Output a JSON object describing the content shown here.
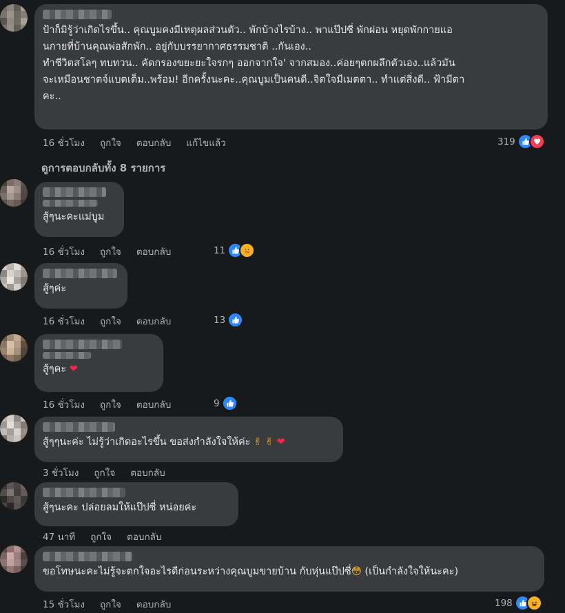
{
  "top_comment": {
    "text": "ป้าก็มิรู้ว่าเกิดไรขึ้น.. คุณบูมคงมีเหตุผลส่วนตัว.. พักบ้างไรบ้าง.. พาแป๊ปซี่ พักผ่อน หยุดพักกายแอ\nนกายที่บ้านคุณพ่อสักพัก.. อยู่กับบรรยากาศธรรมชาติ ..กันเอง..\nทำชีวิตสโลๆ ทบทวน.. คัดกรองขยะยะใจรกๆ ออกจากใจ' จากสมอง..ค่อยๆตกผลึกตัวเอง..แล้วมัน\nจะเหมือนชาตจ์แบตเต็ม..พร้อม! อีกครั้งนะคะ..คุณบูมเป็นคนดี..จิตใจมีเมตตา.. ทำแต่สิ่งดี.. ฟ้ามีตา\nคะ..",
    "time": "16 ชั่วโมง",
    "like": "ถูกใจ",
    "reply": "ตอบกลับ",
    "edited": "แก้ไขแล้ว",
    "reaction_count": "319"
  },
  "view_replies": "ดูการตอบกลับทั้ง 8 รายการ",
  "replies": [
    {
      "text": "สู้ๆนะคะแม่บูม",
      "time": "16 ชั่วโมง",
      "like": "ถูกใจ",
      "reply": "ตอบกลับ",
      "reaction_count": "11"
    },
    {
      "text": "สู้ๆค่ะ",
      "time": "16 ชั่วโมง",
      "like": "ถูกใจ",
      "reply": "ตอบกลับ",
      "reaction_count": "13"
    },
    {
      "text": "สู้ๆคะ",
      "time": "16 ชั่วโมง",
      "like": "ถูกใจ",
      "reply": "ตอบกลับ",
      "reaction_count": "9"
    },
    {
      "text": "สู้ๆๆนะค่ะ ไม่รู้ว่าเกิดอะไรขึ้น ขอส่งกำลังใจให้ค่ะ",
      "time": "3 ชั่วโมง",
      "like": "ถูกใจ",
      "reply": "ตอบกลับ"
    },
    {
      "text": "สู้ๆนะคะ ปล่อยลมให้แป๊ปซี่ หน่อยค่ะ",
      "time": "47 นาที",
      "like": "ถูกใจ",
      "reply": "ตอบกลับ"
    },
    {
      "text": "ขอโทษนะคะไม่รู้จะตกใจอะไรดีก่อนระหว่างคุณบูมขายบ้าน กับหุ่นแป๊ปซี่",
      "text_suffix": "(เป็นกำลังใจให้นะคะ)",
      "time": "15 ชั่วโมง",
      "like": "ถูกใจ",
      "reply": "ตอบกลับ",
      "reaction_count": "198"
    }
  ],
  "colors": {
    "background": "#18191a",
    "bubble": "#3a3b3c",
    "like": "#2d88ff",
    "love": "#f33e58",
    "meta": "#b0b3b8"
  }
}
